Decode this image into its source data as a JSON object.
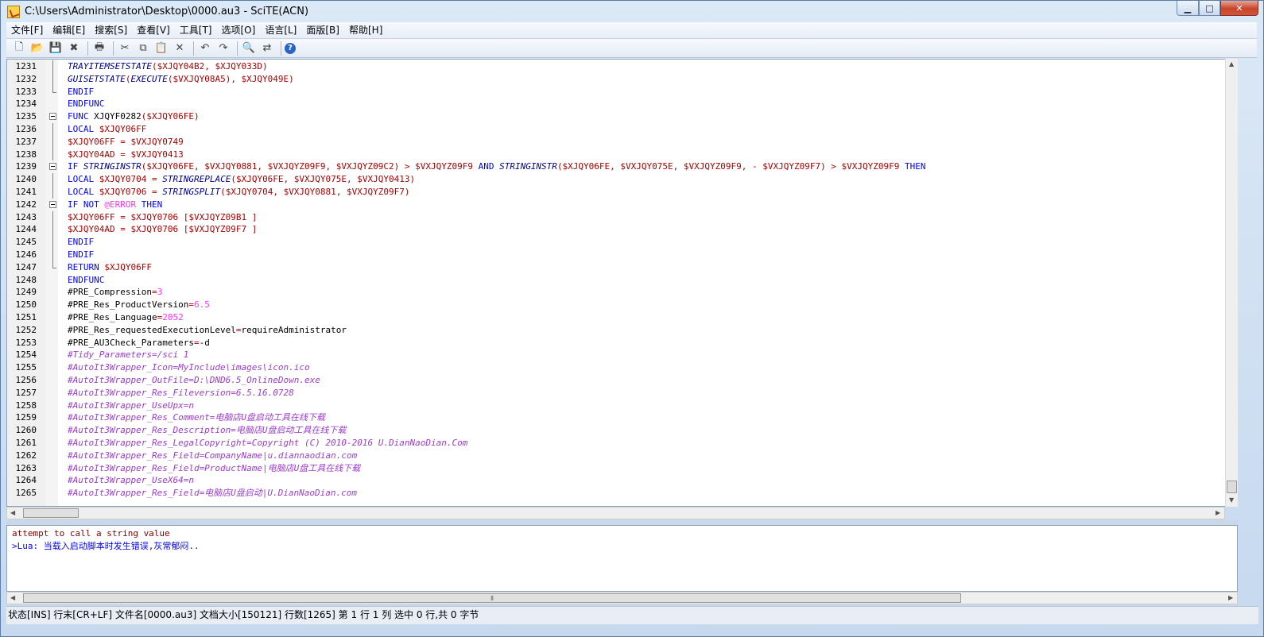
{
  "window": {
    "title": "C:\\Users\\Administrator\\Desktop\\0000.au3 - SciTE(ACN)",
    "min_glyph": "▁",
    "max_glyph": "□",
    "close_glyph": "✕"
  },
  "menu": [
    "文件[F]",
    "编辑[E]",
    "搜索[S]",
    "查看[V]",
    "工具[T]",
    "选项[O]",
    "语言[L]",
    "面版[B]",
    "帮助[H]"
  ],
  "toolbar": [
    {
      "name": "new-file-icon",
      "glyph": "🗋"
    },
    {
      "name": "open-file-icon",
      "glyph": "📂"
    },
    {
      "name": "save-icon",
      "glyph": "💾"
    },
    {
      "name": "close-file-icon",
      "glyph": "✖"
    },
    {
      "sep": true
    },
    {
      "name": "print-icon",
      "glyph": "🖶"
    },
    {
      "sep": true
    },
    {
      "name": "cut-icon",
      "glyph": "✂"
    },
    {
      "name": "copy-icon",
      "glyph": "⧉"
    },
    {
      "name": "paste-icon",
      "glyph": "📋"
    },
    {
      "name": "delete-icon",
      "glyph": "✕"
    },
    {
      "sep": true
    },
    {
      "name": "undo-icon",
      "glyph": "↶"
    },
    {
      "name": "redo-icon",
      "glyph": "↷"
    },
    {
      "sep": true
    },
    {
      "name": "find-icon",
      "glyph": "🔍"
    },
    {
      "name": "replace-icon",
      "glyph": "⇄"
    },
    {
      "sep": true
    },
    {
      "name": "help-icon",
      "glyph": "?"
    }
  ],
  "colors": {
    "keyword": "#0000ff",
    "func": "#000090",
    "variable": "#aa0000",
    "macro": "#ff33ff",
    "comment": "#9c3ccf",
    "default": "#000000",
    "output_error": "#800000",
    "output_lua": "#0000ff"
  },
  "code_lines": [
    {
      "n": "1231",
      "fold": "mid",
      "spans": [
        [
          "TRAYITEMSETSTATE",
          "func"
        ],
        [
          "(",
          "variable"
        ],
        [
          "$XJQY04B2, $XJQY033D)",
          "variable"
        ]
      ]
    },
    {
      "n": "1232",
      "fold": "mid",
      "spans": [
        [
          "GUISETSTATE",
          "func"
        ],
        [
          "(",
          "variable"
        ],
        [
          "EXECUTE",
          "func"
        ],
        [
          "($VXJQY08A5), $XJQY049E)",
          "variable"
        ]
      ]
    },
    {
      "n": "1233",
      "fold": "end",
      "spans": [
        [
          "ENDIF",
          "keyword"
        ]
      ]
    },
    {
      "n": "1234",
      "fold": "",
      "spans": [
        [
          "ENDFUNC",
          "keyword"
        ]
      ]
    },
    {
      "n": "1235",
      "fold": "head",
      "spans": [
        [
          "FUNC ",
          "keyword"
        ],
        [
          "XJQYF0282",
          "default"
        ],
        [
          "($XJQY06FE)",
          "variable"
        ]
      ]
    },
    {
      "n": "1236",
      "fold": "mid",
      "spans": [
        [
          "LOCAL ",
          "keyword"
        ],
        [
          "$XJQY06FF",
          "variable"
        ]
      ]
    },
    {
      "n": "1237",
      "fold": "mid",
      "spans": [
        [
          "$XJQY06FF = $VXJQY0749",
          "variable"
        ]
      ]
    },
    {
      "n": "1238",
      "fold": "mid",
      "spans": [
        [
          "$XJQY04AD = $VXJQY0413",
          "variable"
        ]
      ]
    },
    {
      "n": "1239",
      "fold": "head",
      "spans": [
        [
          "IF ",
          "keyword"
        ],
        [
          "STRINGINSTR",
          "func"
        ],
        [
          "($XJQY06FE, $VXJQY0881, $VXJQYZ09F9, $VXJQYZ09C2) > $VXJQYZ09F9 ",
          "variable"
        ],
        [
          "AND ",
          "keyword"
        ],
        [
          "STRINGINSTR",
          "func"
        ],
        [
          "($XJQY06FE, $VXJQY075E, $VXJQYZ09F9, - $VXJQYZ09F7) > $VXJQYZ09F9 ",
          "variable"
        ],
        [
          "THEN",
          "keyword"
        ]
      ]
    },
    {
      "n": "1240",
      "fold": "mid",
      "spans": [
        [
          "LOCAL ",
          "keyword"
        ],
        [
          "$XJQY0704 = ",
          "variable"
        ],
        [
          "STRINGREPLACE",
          "func"
        ],
        [
          "($XJQY06FE, $VXJQY075E, $VXJQY0413)",
          "variable"
        ]
      ]
    },
    {
      "n": "1241",
      "fold": "mid",
      "spans": [
        [
          "LOCAL ",
          "keyword"
        ],
        [
          "$XJQY0706 = ",
          "variable"
        ],
        [
          "STRINGSPLIT",
          "func"
        ],
        [
          "($XJQY0704, $VXJQY0881, $VXJQYZ09F7)",
          "variable"
        ]
      ]
    },
    {
      "n": "1242",
      "fold": "head",
      "spans": [
        [
          "IF NOT ",
          "keyword"
        ],
        [
          "@ERROR ",
          "macro"
        ],
        [
          "THEN",
          "keyword"
        ]
      ]
    },
    {
      "n": "1243",
      "fold": "mid",
      "spans": [
        [
          "$XJQY06FF = $XJQY0706 [$VXJQYZ09B1 ]",
          "variable"
        ]
      ]
    },
    {
      "n": "1244",
      "fold": "mid",
      "spans": [
        [
          "$XJQY04AD = $XJQY0706 [$VXJQYZ09F7 ]",
          "variable"
        ]
      ]
    },
    {
      "n": "1245",
      "fold": "mid",
      "spans": [
        [
          "ENDIF",
          "keyword"
        ]
      ]
    },
    {
      "n": "1246",
      "fold": "mid",
      "spans": [
        [
          "ENDIF",
          "keyword"
        ]
      ]
    },
    {
      "n": "1247",
      "fold": "end",
      "spans": [
        [
          "RETURN ",
          "keyword"
        ],
        [
          "$XJQY06FF",
          "variable"
        ]
      ]
    },
    {
      "n": "1248",
      "fold": "",
      "spans": [
        [
          "ENDFUNC",
          "keyword"
        ]
      ]
    },
    {
      "n": "1249",
      "fold": "",
      "spans": [
        [
          "#PRE_Compression",
          "default"
        ],
        [
          "=",
          "variable"
        ],
        [
          "3",
          "macro"
        ]
      ]
    },
    {
      "n": "1250",
      "fold": "",
      "spans": [
        [
          "#PRE_Res_ProductVersion",
          "default"
        ],
        [
          "=",
          "variable"
        ],
        [
          "6.5",
          "macro"
        ]
      ]
    },
    {
      "n": "1251",
      "fold": "",
      "spans": [
        [
          "#PRE_Res_Language",
          "default"
        ],
        [
          "=",
          "variable"
        ],
        [
          "2052",
          "macro"
        ]
      ]
    },
    {
      "n": "1252",
      "fold": "",
      "spans": [
        [
          "#PRE_Res_requestedExecutionLevel",
          "default"
        ],
        [
          "=",
          "variable"
        ],
        [
          "requireAdministrator",
          "default"
        ]
      ]
    },
    {
      "n": "1253",
      "fold": "",
      "spans": [
        [
          "#PRE_AU3Check_Parameters",
          "default"
        ],
        [
          "=",
          "variable"
        ],
        [
          "-d",
          "default"
        ]
      ]
    },
    {
      "n": "1254",
      "fold": "",
      "spans": [
        [
          "#Tidy_Parameters=/sci 1",
          "comment"
        ]
      ]
    },
    {
      "n": "1255",
      "fold": "",
      "spans": [
        [
          "#AutoIt3Wrapper_Icon=MyInclude\\images\\icon.ico",
          "comment"
        ]
      ]
    },
    {
      "n": "1256",
      "fold": "",
      "spans": [
        [
          "#AutoIt3Wrapper_OutFile=D:\\DND6.5_OnlineDown.exe",
          "comment"
        ]
      ]
    },
    {
      "n": "1257",
      "fold": "",
      "spans": [
        [
          "#AutoIt3Wrapper_Res_Fileversion=6.5.16.0728",
          "comment"
        ]
      ]
    },
    {
      "n": "1258",
      "fold": "",
      "spans": [
        [
          "#AutoIt3Wrapper_UseUpx=n",
          "comment"
        ]
      ]
    },
    {
      "n": "1259",
      "fold": "",
      "spans": [
        [
          "#AutoIt3Wrapper_Res_Comment=电脑店U盘启动工具在线下载",
          "comment"
        ]
      ]
    },
    {
      "n": "1260",
      "fold": "",
      "spans": [
        [
          "#AutoIt3Wrapper_Res_Description=电脑店U盘启动工具在线下载",
          "comment"
        ]
      ]
    },
    {
      "n": "1261",
      "fold": "",
      "spans": [
        [
          "#AutoIt3Wrapper_Res_LegalCopyright=Copyright (C) 2010-2016 U.DianNaoDian.Com",
          "comment"
        ]
      ]
    },
    {
      "n": "1262",
      "fold": "",
      "spans": [
        [
          "#AutoIt3Wrapper_Res_Field=CompanyName|u.diannaodian.com",
          "comment"
        ]
      ]
    },
    {
      "n": "1263",
      "fold": "",
      "spans": [
        [
          "#AutoIt3Wrapper_Res_Field=ProductName|电脑店U盘工具在线下载",
          "comment"
        ]
      ]
    },
    {
      "n": "1264",
      "fold": "",
      "spans": [
        [
          "#AutoIt3Wrapper_UseX64=n",
          "comment"
        ]
      ]
    },
    {
      "n": "1265",
      "fold": "",
      "spans": [
        [
          "#AutoIt3Wrapper_Res_Field=电脑店U盘启动|U.DianNaoDian.com",
          "comment"
        ]
      ]
    }
  ],
  "output": {
    "line1": "attempt to call a string value",
    "line2": ">Lua: 当载入启动脚本时发生错误,灰常郁闷.."
  },
  "status": "状态[INS] 行末[CR+LF] 文件名[0000.au3] 文档大小[150121] 行数[1265] 第 1 行 1 列 选中 0 行,共 0 字节"
}
